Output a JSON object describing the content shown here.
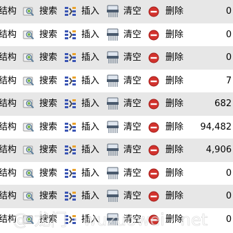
{
  "actions": {
    "structure": "结构",
    "search": "搜索",
    "insert": "插入",
    "empty": "清空",
    "drop": "删除"
  },
  "rows": [
    {
      "count": "0"
    },
    {
      "count": "0"
    },
    {
      "count": "0"
    },
    {
      "count": "7"
    },
    {
      "count": "682"
    },
    {
      "count": "94,482"
    },
    {
      "count": "4,906"
    },
    {
      "count": "0"
    },
    {
      "count": "0"
    },
    {
      "count": "0"
    }
  ],
  "watermark": {
    "text": "@ 龙门 · wuzuowei · net"
  },
  "colors": {
    "row_odd": "#e7e7e7",
    "row_even": "#ffffff",
    "delete_icon": "#d2322d",
    "search_icon_lens": "#7ab648",
    "insert_icon_blue": "#3a55b4"
  }
}
